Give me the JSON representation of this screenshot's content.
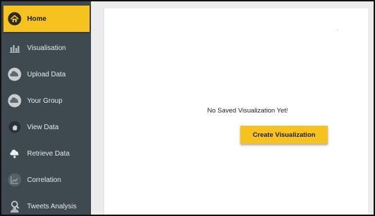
{
  "sidebar": {
    "items": [
      {
        "label": "Home",
        "icon": "home-icon"
      },
      {
        "label": "Visualisation",
        "icon": "bar-chart-icon"
      },
      {
        "label": "Upload Data",
        "icon": "cloud-upload-icon"
      },
      {
        "label": "Your Group",
        "icon": "cloud-icon"
      },
      {
        "label": "View Data",
        "icon": "hand-icon"
      },
      {
        "label": "Retrieve Data",
        "icon": "cloud-download-icon"
      },
      {
        "label": "Correlation",
        "icon": "line-chart-icon"
      },
      {
        "label": "Tweets Analysis",
        "icon": "user-search-icon"
      }
    ]
  },
  "main": {
    "empty_message": "No Saved Visualization Yet!",
    "create_button_label": "Create Visualization"
  },
  "colors": {
    "sidebar_bg": "#3f4950",
    "accent": "#f6c21f",
    "content_bg": "#ffffff"
  }
}
